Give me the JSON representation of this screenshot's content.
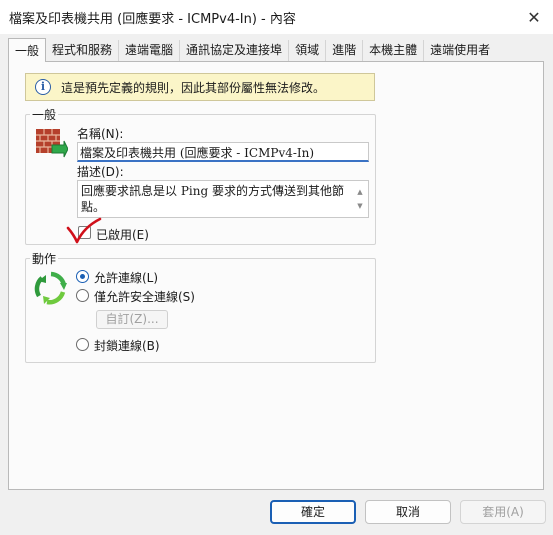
{
  "window": {
    "title": "檔案及印表機共用 (回應要求 - ICMPv4-In) - 內容",
    "close_glyph": "✕"
  },
  "tabs": [
    {
      "label": "一般",
      "active": true
    },
    {
      "label": "程式和服務"
    },
    {
      "label": "遠端電腦"
    },
    {
      "label": "通訊協定及連接埠"
    },
    {
      "label": "領域"
    },
    {
      "label": "進階"
    },
    {
      "label": "本機主體"
    },
    {
      "label": "遠端使用者"
    }
  ],
  "info_bar": {
    "icon": "info-icon",
    "icon_glyph": "i",
    "text": "這是預先定義的規則，因此其部份屬性無法修改。"
  },
  "general": {
    "legend": "一般",
    "name_label": "名稱(N):",
    "name_value": "檔案及印表機共用 (回應要求 - ICMPv4-In)",
    "desc_label": "描述(D):",
    "desc_value": "回應要求訊息是以 Ping 要求的方式傳送到其他節點。",
    "enabled_label": "已啟用(E)",
    "enabled_checked": false
  },
  "action": {
    "legend": "動作",
    "allow_label": "允許連線(L)",
    "allow_secure_label": "僅允許安全連線(S)",
    "customize_label": "自訂(Z)...",
    "block_label": "封鎖連線(B)",
    "selected": "allow"
  },
  "footer": {
    "ok_label": "確定",
    "cancel_label": "取消",
    "apply_label": "套用(A)"
  },
  "colors": {
    "accent": "#1a5fb4",
    "annotation": "#d0101a",
    "info_bg": "#fbf5c8"
  }
}
